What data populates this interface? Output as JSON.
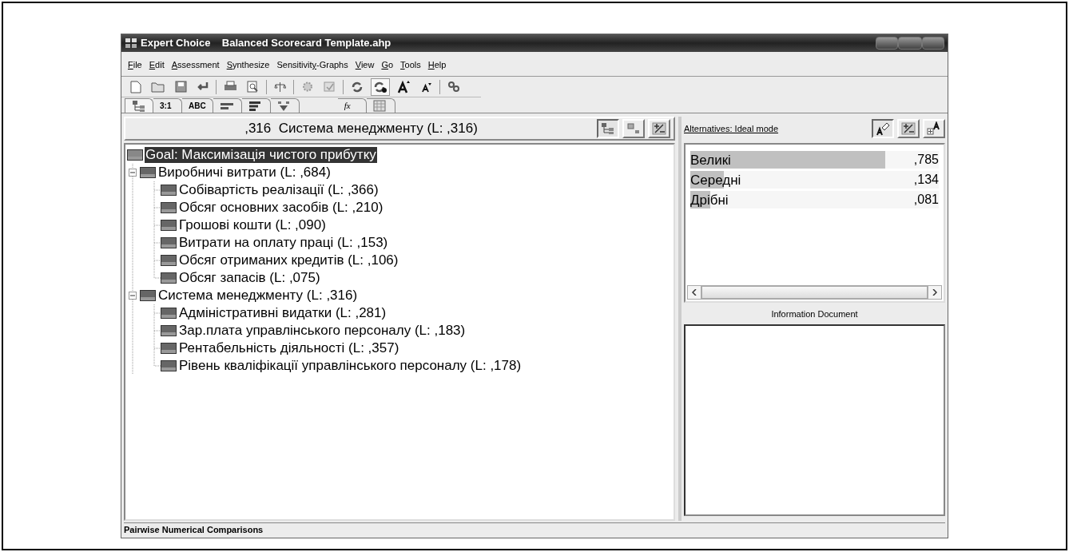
{
  "window": {
    "title": "Expert Choice    Balanced Scorecard Template.ahp"
  },
  "menu": [
    {
      "mnemonic": "F",
      "after": "ile"
    },
    {
      "mnemonic": "E",
      "after": "dit"
    },
    {
      "mnemonic": "A",
      "after": "ssessment"
    },
    {
      "mnemonic": "S",
      "after": "ynthesize"
    },
    {
      "before": "Sensitivit",
      "mnemonic": "y",
      "after": "-Graphs"
    },
    {
      "mnemonic": "V",
      "after": "iew"
    },
    {
      "mnemonic": "G",
      "after": "o"
    },
    {
      "mnemonic": "T",
      "after": "ools"
    },
    {
      "mnemonic": "H",
      "after": "elp"
    }
  ],
  "toolbar": [
    {
      "kind": "new",
      "pressed": false
    },
    {
      "kind": "open",
      "pressed": false
    },
    {
      "kind": "save",
      "pressed": false
    },
    {
      "kind": "undo",
      "pressed": false
    },
    {
      "kind": "sep"
    },
    {
      "kind": "print",
      "pressed": false
    },
    {
      "kind": "preview",
      "pressed": false
    },
    {
      "kind": "sep"
    },
    {
      "kind": "scale",
      "pressed": false
    },
    {
      "kind": "sep"
    },
    {
      "kind": "gear",
      "pressed": false
    },
    {
      "kind": "doc",
      "pressed": false
    },
    {
      "kind": "sep"
    },
    {
      "kind": "cycle",
      "pressed": false
    },
    {
      "kind": "cycle2",
      "pressed": true
    },
    {
      "kind": "fontup",
      "pressed": false
    },
    {
      "kind": "fontdown",
      "pressed": false
    },
    {
      "kind": "sep"
    },
    {
      "kind": "link",
      "pressed": false
    }
  ],
  "tabs": [
    {
      "kind": "tree",
      "selected": true
    },
    {
      "kind": "text",
      "label": "3:1",
      "selected": false
    },
    {
      "kind": "text",
      "label": "ABC",
      "selected": false
    },
    {
      "kind": "bars1",
      "selected": false
    },
    {
      "kind": "bars2",
      "selected": false
    },
    {
      "kind": "funnel",
      "selected": false
    },
    {
      "kind": "fx",
      "label": "fx",
      "selected": false
    },
    {
      "kind": "grid",
      "selected": false
    }
  ],
  "header": {
    "text": ",316  Система менеджменту (L: ,316)",
    "buttons": [
      {
        "kind": "tree",
        "pressed": true
      },
      {
        "kind": "node",
        "pressed": false
      },
      {
        "kind": "plusminus",
        "pressed": false
      }
    ]
  },
  "tree": {
    "label": "Goal: Максимізація чистого прибутку",
    "selected": true,
    "children": [
      {
        "label": "Виробничі витрати (L: ,684)",
        "selected": false,
        "expanded": true,
        "children": [
          {
            "label": "Собівартість реалізації (L: ,366)",
            "selected": false
          },
          {
            "label": "Обсяг основних засобів (L: ,210)",
            "selected": false
          },
          {
            "label": "Грошові кошти (L: ,090)",
            "selected": false
          },
          {
            "label": "Витрати на оплату праці (L: ,153)",
            "selected": false
          },
          {
            "label": "Обсяг отриманих кредитів (L: ,106)",
            "selected": false
          },
          {
            "label": "Обсяг запасів (L: ,075)",
            "selected": false
          }
        ]
      },
      {
        "label": "Система менеджменту (L: ,316)",
        "selected": false,
        "expanded": true,
        "children": [
          {
            "label": "Адміністративні видатки (L: ,281)",
            "selected": false
          },
          {
            "label": "Зар.плата управлінського персоналу (L: ,183)",
            "selected": false
          },
          {
            "label": "Рентабельність діяльності (L: ,357)",
            "selected": false
          },
          {
            "label": "Рівень кваліфікації управлінського персоналу (L: ,178)",
            "selected": false
          }
        ]
      }
    ]
  },
  "alternatives": {
    "title": "Alternatives: Ideal mode",
    "buttons": [
      {
        "kind": "pen",
        "pressed": true
      },
      {
        "kind": "plusminus",
        "pressed": false
      },
      {
        "kind": "addalt",
        "pressed": false
      }
    ],
    "items": [
      {
        "name": "Великі",
        "level": 0.785,
        "value": ",785"
      },
      {
        "name": "Середні",
        "level": 0.134,
        "value": ",134"
      },
      {
        "name": "Дрібні",
        "level": 0.081,
        "value": ",081"
      }
    ]
  },
  "information_document": {
    "title": "Information Document"
  },
  "status_bar": "Pairwise Numerical Comparisons"
}
